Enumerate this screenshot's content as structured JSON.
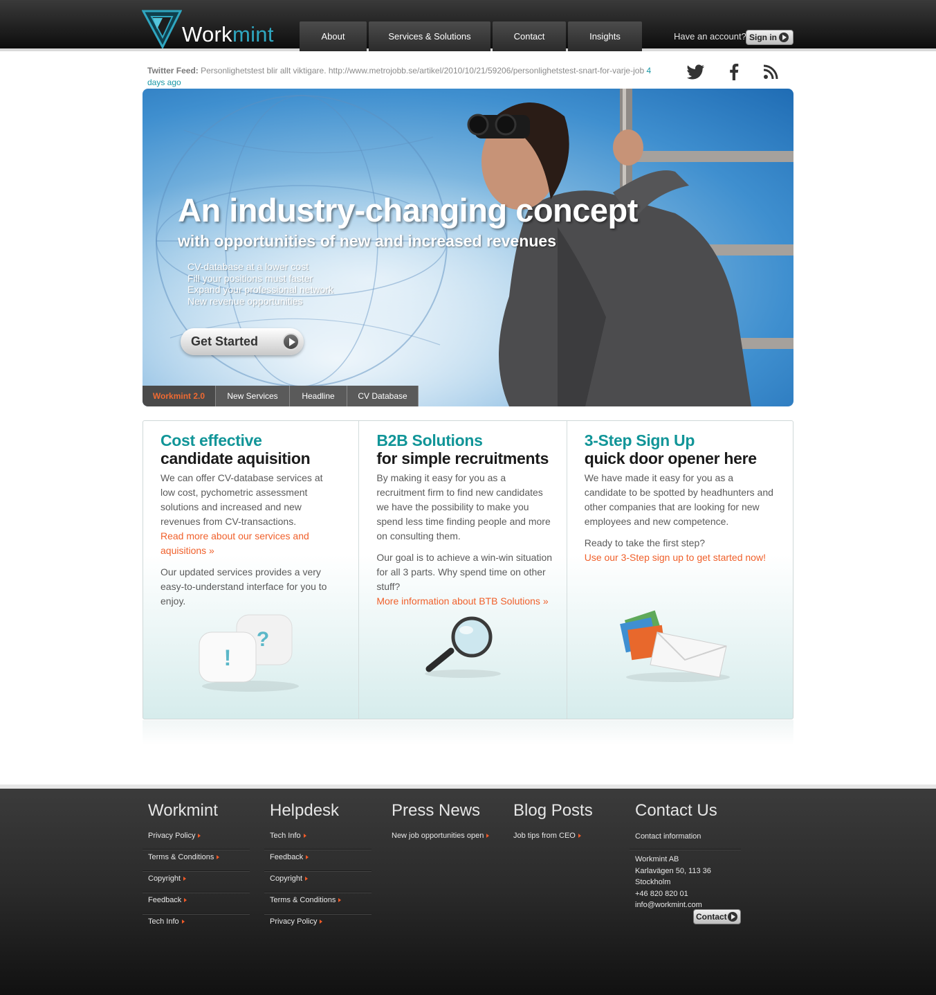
{
  "header": {
    "logo": {
      "text_main": "Work",
      "text_accent": "mint"
    },
    "nav": [
      {
        "label": "About"
      },
      {
        "label": "Services & Solutions"
      },
      {
        "label": "Contact"
      },
      {
        "label": "Insights"
      }
    ],
    "account_prompt": "Have an account?",
    "signin_label": "Sign in"
  },
  "twitter": {
    "label": "Twitter Feed:",
    "text": "Personlighetstest blir allt viktigare. http://www.metrojobb.se/artikel/2010/10/21/59206/personlighetstest-snart-for-varje-job",
    "time": "4 days ago"
  },
  "social": [
    "twitter-icon",
    "facebook-icon",
    "rss-icon"
  ],
  "hero": {
    "title": "An industry-changing concept",
    "subtitle": "with opportunities of new and increased revenues",
    "bullets": [
      "CV-database at a lower cost",
      "Fill your positions must faster",
      "Expand your professional network",
      "New revenue opportunities"
    ],
    "cta": "Get Started",
    "tabs": [
      {
        "label": "Workmint 2.0",
        "active": true
      },
      {
        "label": "New Services",
        "active": false
      },
      {
        "label": "Headline",
        "active": false
      },
      {
        "label": "CV Database",
        "active": false
      }
    ]
  },
  "columns": [
    {
      "title1": "Cost effective",
      "title2": "candidate aquisition",
      "p1": "We can offer CV-database services at low cost, pychometric assessment solutions and increased and new revenues from CV-transactions.",
      "link1": "Read more about our services and aquisitions »",
      "p2": "Our updated services provides a very easy-to-understand interface for you to enjoy.",
      "icon": "speech-bubbles-icon"
    },
    {
      "title1": "B2B Solutions",
      "title2": "for simple recruitments",
      "p1": "By making it easy for you as a recruitment firm to find new candidates we have the possibility to make you spend less time finding people and more on consulting them.",
      "p2": "Our goal is to achieve a win-win situation for all 3 parts. Why spend time on other stuff?",
      "link2": "More information about BTB Solutions »",
      "icon": "magnifier-icon"
    },
    {
      "title1": "3-Step Sign Up",
      "title2": "quick door opener here",
      "p1": "We have made it easy for you as a candidate to be spotted by headhunters and other companies that are looking for new employees and new competence.",
      "p2": "Ready to take the first step?",
      "link2": "Use our 3-Step sign up to get started now!",
      "icon": "envelope-icon"
    }
  ],
  "footer": {
    "workmint": {
      "title": "Workmint",
      "items": [
        "Privacy Policy",
        "Terms & Conditions",
        "Copyright",
        "Feedback",
        "Tech Info"
      ]
    },
    "helpdesk": {
      "title": "Helpdesk",
      "items": [
        "Tech Info",
        "Feedback",
        "Copyright",
        "Terms & Conditions",
        "Privacy Policy"
      ]
    },
    "press": {
      "title": "Press News",
      "items": [
        "New job opportunities open"
      ]
    },
    "blog": {
      "title": "Blog Posts",
      "items": [
        "Job tips from CEO"
      ]
    },
    "contact": {
      "title": "Contact Us",
      "subtitle": "Contact information",
      "lines": [
        "Workmint AB",
        "Karlavägen 50, 113 36",
        "Stockholm",
        "+46 820 820 01",
        "info@workmint.com"
      ],
      "button": "Contact"
    }
  },
  "colors": {
    "accent_teal": "#119598",
    "accent_orange": "#f0602b",
    "link_blue": "#1797a6"
  }
}
